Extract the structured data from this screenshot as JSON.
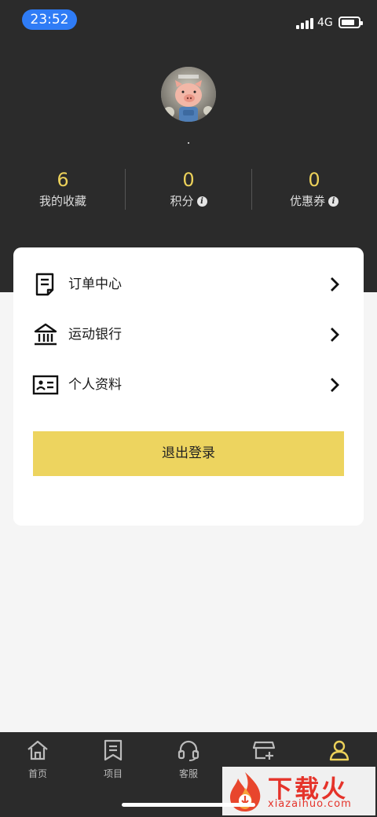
{
  "status_bar": {
    "time": "23:52",
    "network": "4G",
    "signal_bars": 4,
    "battery_level": 0.75
  },
  "profile": {
    "nickname": "."
  },
  "stats": [
    {
      "value": "6",
      "label": "我的收藏",
      "has_info": false
    },
    {
      "value": "0",
      "label": "积分",
      "has_info": true
    },
    {
      "value": "0",
      "label": "优惠券",
      "has_info": true
    }
  ],
  "menu": [
    {
      "label": "订单中心",
      "icon": "order-icon"
    },
    {
      "label": "运动银行",
      "icon": "bank-icon"
    },
    {
      "label": "个人资料",
      "icon": "id-card-icon"
    }
  ],
  "logout_label": "退出登录",
  "tabs": [
    {
      "label": "首页",
      "icon": "home-icon",
      "active": false
    },
    {
      "label": "项目",
      "icon": "bookmark-list-icon",
      "active": false
    },
    {
      "label": "客服",
      "icon": "headset-icon",
      "active": false
    },
    {
      "label": "",
      "icon": "store-icon",
      "active": false
    },
    {
      "label": "",
      "icon": "user-icon",
      "active": true
    }
  ],
  "watermark": {
    "title": "下载火",
    "subtitle": "xiazaihuo.com"
  },
  "colors": {
    "header_bg": "#2b2b2b",
    "accent": "#ecd15a",
    "button": "#edd45f",
    "page_bg": "#f5f5f5"
  }
}
